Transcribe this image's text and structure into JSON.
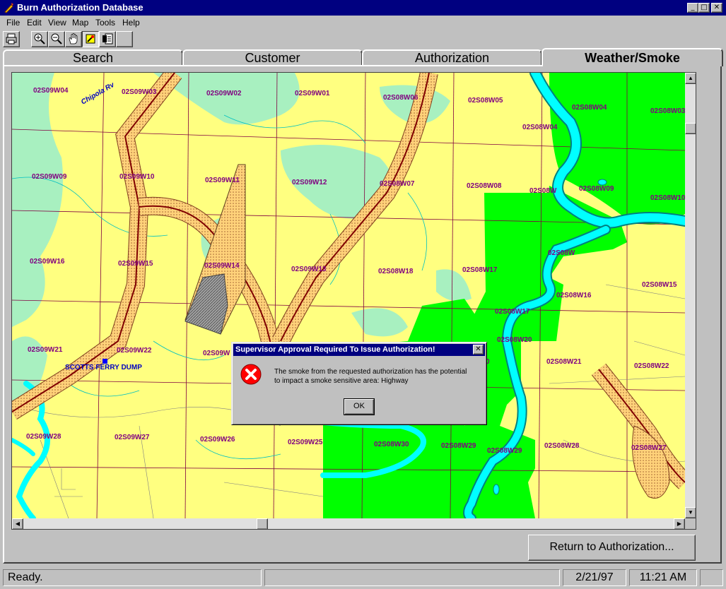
{
  "window": {
    "title": "Burn Authorization Database",
    "icon": "fire-icon"
  },
  "caption_buttons": {
    "minimize": "_",
    "maximize": "□",
    "close": "✕"
  },
  "menu": {
    "items": [
      "File",
      "Edit",
      "View",
      "Map",
      "Tools",
      "Help"
    ]
  },
  "toolbar": {
    "buttons": [
      "print-icon",
      "zoom-in-icon",
      "zoom-out-icon",
      "pan-hand-icon",
      "identify-icon",
      "report-icon"
    ]
  },
  "tabs": [
    {
      "label": "Search",
      "active": false
    },
    {
      "label": "Customer",
      "active": false
    },
    {
      "label": "Authorization",
      "active": false
    },
    {
      "label": "Weather/Smoke",
      "active": true
    }
  ],
  "map": {
    "colors": {
      "land": "#ffff80",
      "wildlife": "#00ff00",
      "forest": "#80ffc0",
      "water": "#00ffff",
      "highway": "#800000",
      "smoke": "#ff8000"
    },
    "river_label": "Chipola Rv",
    "place_label": "SCOTTS FERRY DUMP",
    "sections": [
      "02S09W04",
      "02S09W03",
      "02S09W02",
      "02S09W01",
      "02S08W06",
      "02S08W05",
      "02S08W04",
      "02S08W04",
      "02S08W03",
      "02S09W09",
      "02S09W10",
      "02S09W11",
      "02S09W12",
      "02S08W07",
      "02S08W08",
      "02S08W",
      "02S08W09",
      "02S08W10",
      "02S09W16",
      "02S09W15",
      "02S09W14",
      "02S09W13",
      "02S08W18",
      "02S08W17",
      "02S08W",
      "02S08W16",
      "02S08W15",
      "02S08W17",
      "02S09W21",
      "02S09W22",
      "02S09W",
      "02S08W20",
      "02S08W21",
      "02S08W22",
      "0",
      "02S09W28",
      "02S09W27",
      "02S09W26",
      "02S09W25",
      "02S08W30",
      "02S08W29",
      "02S08W29",
      "02S08W28",
      "02S08W27"
    ]
  },
  "dialog": {
    "title": "Supervisor Approval Required To Issue Authorization!",
    "icon": "error-stop-icon",
    "message_line1": "The smoke from the requested authorization has the potential",
    "message_line2": "to impact a smoke sensitive area:  Highway",
    "ok_label": "OK",
    "close": "✕"
  },
  "return_button": {
    "label": "Return to Authorization..."
  },
  "status": {
    "message": "Ready.",
    "date": "2/21/97",
    "time": "11:21 AM"
  },
  "scroll": {
    "up": "▲",
    "down": "▼",
    "left": "◀",
    "right": "▶"
  }
}
